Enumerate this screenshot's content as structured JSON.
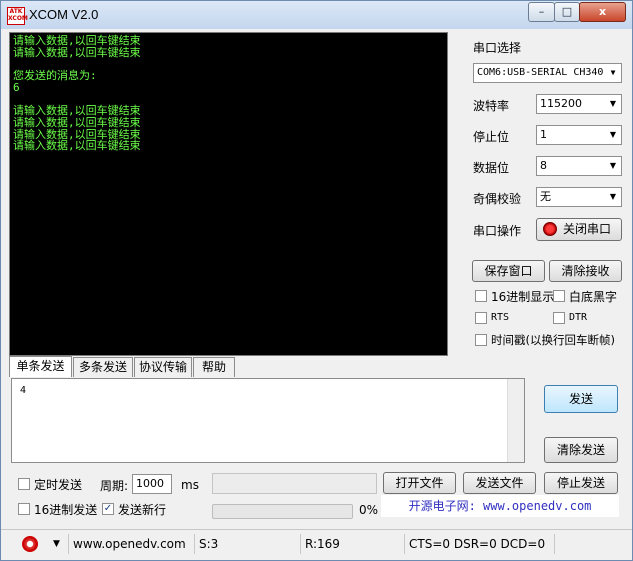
{
  "window": {
    "title": "XCOM V2.0",
    "logo_text": "ATK XCOM",
    "controls": {
      "minimize": "–",
      "maximize": "□",
      "close": "x"
    }
  },
  "terminal": {
    "lines": [
      "请输入数据,以回车键结束",
      "请输入数据,以回车键结束",
      "",
      "您发送的消息为:",
      "6",
      "",
      "请输入数据,以回车键结束",
      "请输入数据,以回车键结束",
      "请输入数据,以回车键结束",
      "请输入数据,以回车键结束"
    ],
    "text_color": "#6cff4a",
    "background": "#000000"
  },
  "serial": {
    "port_label": "串口选择",
    "port_value": "COM6:USB-SERIAL CH340",
    "baud_label": "波特率",
    "baud_value": "115200",
    "stopbit_label": "停止位",
    "stopbit_value": "1",
    "databit_label": "数据位",
    "databit_value": "8",
    "parity_label": "奇偶校验",
    "parity_value": "无",
    "op_label": "串口操作",
    "op_button": "关闭串口",
    "save_window": "保存窗口",
    "clear_recv": "清除接收",
    "hex_display": "16进制显示",
    "white_bg": "白底黑字",
    "rts": "RTS",
    "dtr": "DTR",
    "timestamp": "时间戳(以换行回车断帧)"
  },
  "tabs": [
    "单条发送",
    "多条发送",
    "协议传输",
    "帮助"
  ],
  "send": {
    "input_value": "4",
    "send_button": "发送",
    "clear_send": "清除发送",
    "timed_send": "定时发送",
    "period_label": "周期:",
    "period_value": "1000",
    "period_unit": "ms",
    "open_file": "打开文件",
    "send_file": "发送文件",
    "stop_send": "停止发送",
    "hex_send": "16进制发送",
    "send_newline": "发送新行",
    "progress_text": "0%",
    "progress_fraction": 0,
    "website_text": "开源电子网: www.openedv.com"
  },
  "status": {
    "url": "www.openedv.com",
    "sent": "S:3",
    "received": "R:169",
    "lines": "CTS=0 DSR=0 DCD=0"
  }
}
